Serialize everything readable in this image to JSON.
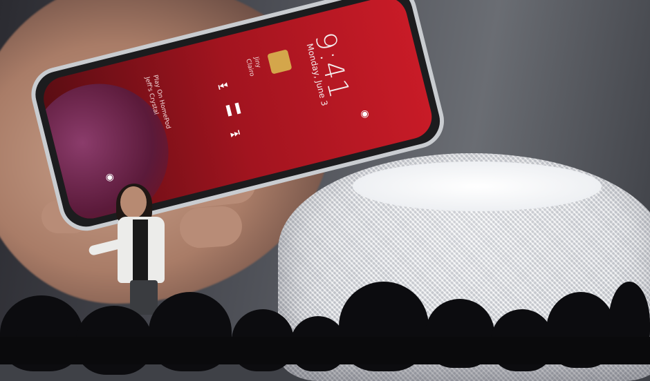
{
  "photo": {
    "subject": "keynote-stage",
    "colors": {
      "backdrop": "#4d4f56",
      "phone_wallpaper": "#a2141f",
      "homepod": "#eef0f3",
      "audience": "#0c0c0f"
    }
  },
  "phone_lock_screen": {
    "time": "9:41",
    "date": "Monday, June 3",
    "song_title": "Jiny",
    "song_artist": "Clairo",
    "device_hint": "Play On HomePod",
    "device_hint_sub": "Jeff's Crystal"
  }
}
